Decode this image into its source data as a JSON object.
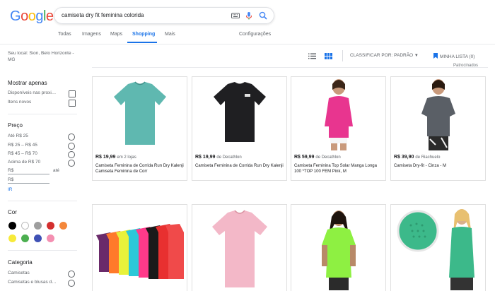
{
  "logo": {
    "letters": [
      "G",
      "o",
      "o",
      "g",
      "l",
      "e"
    ],
    "colors": [
      "#4285f4",
      "#ea4335",
      "#fbbc05",
      "#4285f4",
      "#34a853",
      "#ea4335"
    ]
  },
  "search": {
    "query": "camiseta dry fit feminina colorida"
  },
  "tabs": [
    {
      "label": "Todas"
    },
    {
      "label": "Imagens"
    },
    {
      "label": "Maps"
    },
    {
      "label": "Shopping"
    },
    {
      "label": "Mais"
    }
  ],
  "settings_label": "Configurações",
  "location": "Seu local: Sion, Belo Horizonte - MG",
  "toolbar": {
    "sort_label": "CLASSIFICAR POR: PADRÃO",
    "wishlist_label": "MINHA LISTA (0)",
    "sponsored": "Patrocinados"
  },
  "filters": {
    "show_only_title": "Mostrar apenas",
    "show_only": [
      "Disponíveis nas proxi…",
      "Itens novos"
    ],
    "price_title": "Preço",
    "price_ranges": [
      "Até R$ 25",
      "R$ 25 – R$ 45",
      "R$ 45 – R$ 70",
      "Acima de R$ 70"
    ],
    "price_min_prefix": "R$",
    "price_to": "até",
    "price_max_prefix": "R$",
    "apply_label": "IR",
    "color_title": "Cor",
    "colors": [
      "#000000",
      "#ffffff",
      "#9e9e9e",
      "#d32f2f",
      "#f4873b",
      "#f7ea3a",
      "#4caf50",
      "#3f51b5",
      "#f48fb1"
    ],
    "category_title": "Categoria",
    "categories": [
      "Camisetas",
      "Camisetas e blusas d…"
    ]
  },
  "products": [
    {
      "price": "R$ 19,99",
      "seller": "em 2 lojas",
      "title": "Camiseta Feminina de Corrida Run Dry Kalenji Camiseta Feminina de Corr",
      "shirt_color": "#5fb8b0"
    },
    {
      "price": "R$ 19,99",
      "seller": "de Decathlon",
      "title": "Camiseta Feminina de Corrida Run Dry Kalenji",
      "shirt_color": "#1f1f22"
    },
    {
      "price": "R$ 59,99",
      "seller": "de Decathlon",
      "title": "Camiseta Feminina Top Solar Manga Longa 100 *TOP 100 FEM Pink, M",
      "shirt_color": "#e8358f"
    },
    {
      "price": "R$ 39,90",
      "seller": "de Riachuelo",
      "title": "Camiseta Dry-fit - Cinza - M",
      "shirt_color": "#5a5f66"
    },
    {
      "shirt_color": "#f04a4a"
    },
    {
      "shirt_color": "#f3b8c8"
    },
    {
      "shirt_color": "#8ef042"
    },
    {
      "shirt_color": "#3cb98a"
    }
  ]
}
